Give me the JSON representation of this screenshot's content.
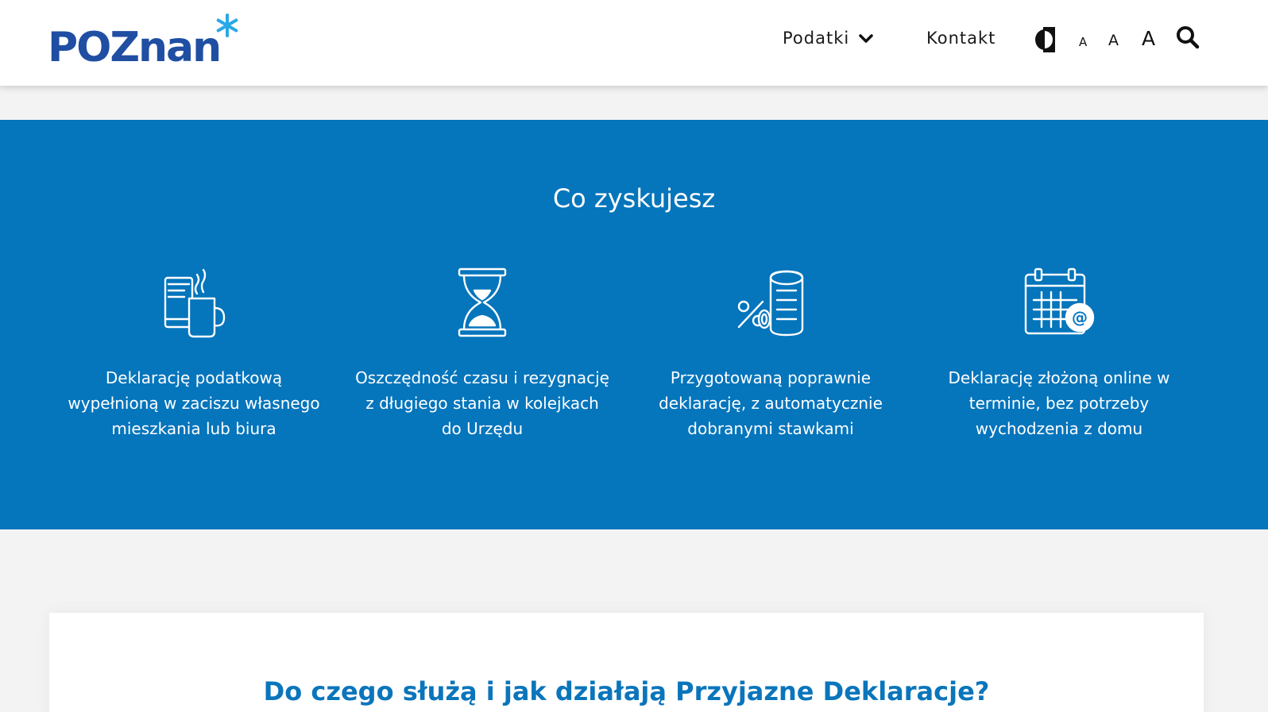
{
  "header": {
    "logo_text": "POZnan",
    "nav": {
      "podatki": "Podatki",
      "kontakt": "Kontakt"
    },
    "font_size_small": "A",
    "font_size_medium": "A",
    "font_size_large": "A"
  },
  "band": {
    "title": "Co zyskujesz",
    "benefits": [
      {
        "icon": "phone-mug-icon",
        "text": "Deklarację podatkową wypełnioną w zaciszu własnego mieszkania lub biura"
      },
      {
        "icon": "hourglass-icon",
        "text": "Oszczędność czasu i rezygnację z długiego stania w kolejkach do Urzędu"
      },
      {
        "icon": "percent-coins-icon",
        "text": "Przygotowaną poprawnie deklarację, z automatycznie dobranymi stawkami"
      },
      {
        "icon": "calendar-at-icon",
        "text": "Deklarację złożoną online w terminie, bez potrzeby wychodzenia z domu"
      }
    ]
  },
  "card": {
    "title": "Do czego służą i jak działają Przyjazne Deklaracje?"
  },
  "colors": {
    "brand_blue": "#1f4ea3",
    "star_blue": "#29a9e6",
    "band_blue": "#0575bc",
    "title_blue": "#0a75bb"
  }
}
